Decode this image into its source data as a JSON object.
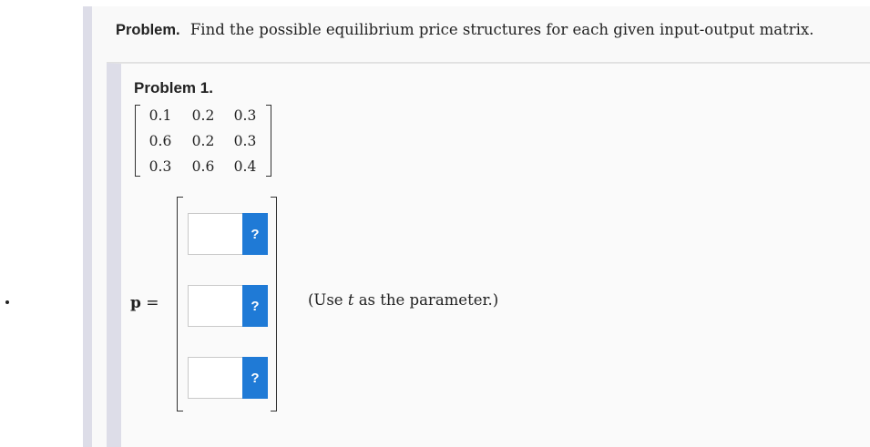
{
  "problem": {
    "label": "Problem.",
    "text": "Find the possible equilibrium price structures for each given input-output matrix."
  },
  "sub_problem": {
    "title": "Problem 1.",
    "matrix": [
      [
        "0.1",
        "0.2",
        "0.3"
      ],
      [
        "0.6",
        "0.2",
        "0.3"
      ],
      [
        "0.3",
        "0.6",
        "0.4"
      ]
    ]
  },
  "answer": {
    "vector_symbol": "p",
    "equals": "=",
    "fields": [
      {
        "value": "",
        "help_label": "?"
      },
      {
        "value": "",
        "help_label": "?"
      },
      {
        "value": "",
        "help_label": "?"
      }
    ],
    "note_prefix": "(Use ",
    "note_var": "t",
    "note_suffix": " as the parameter.)"
  },
  "colors": {
    "help_button": "#1f7ad6",
    "side_bar": "#dddde8"
  }
}
